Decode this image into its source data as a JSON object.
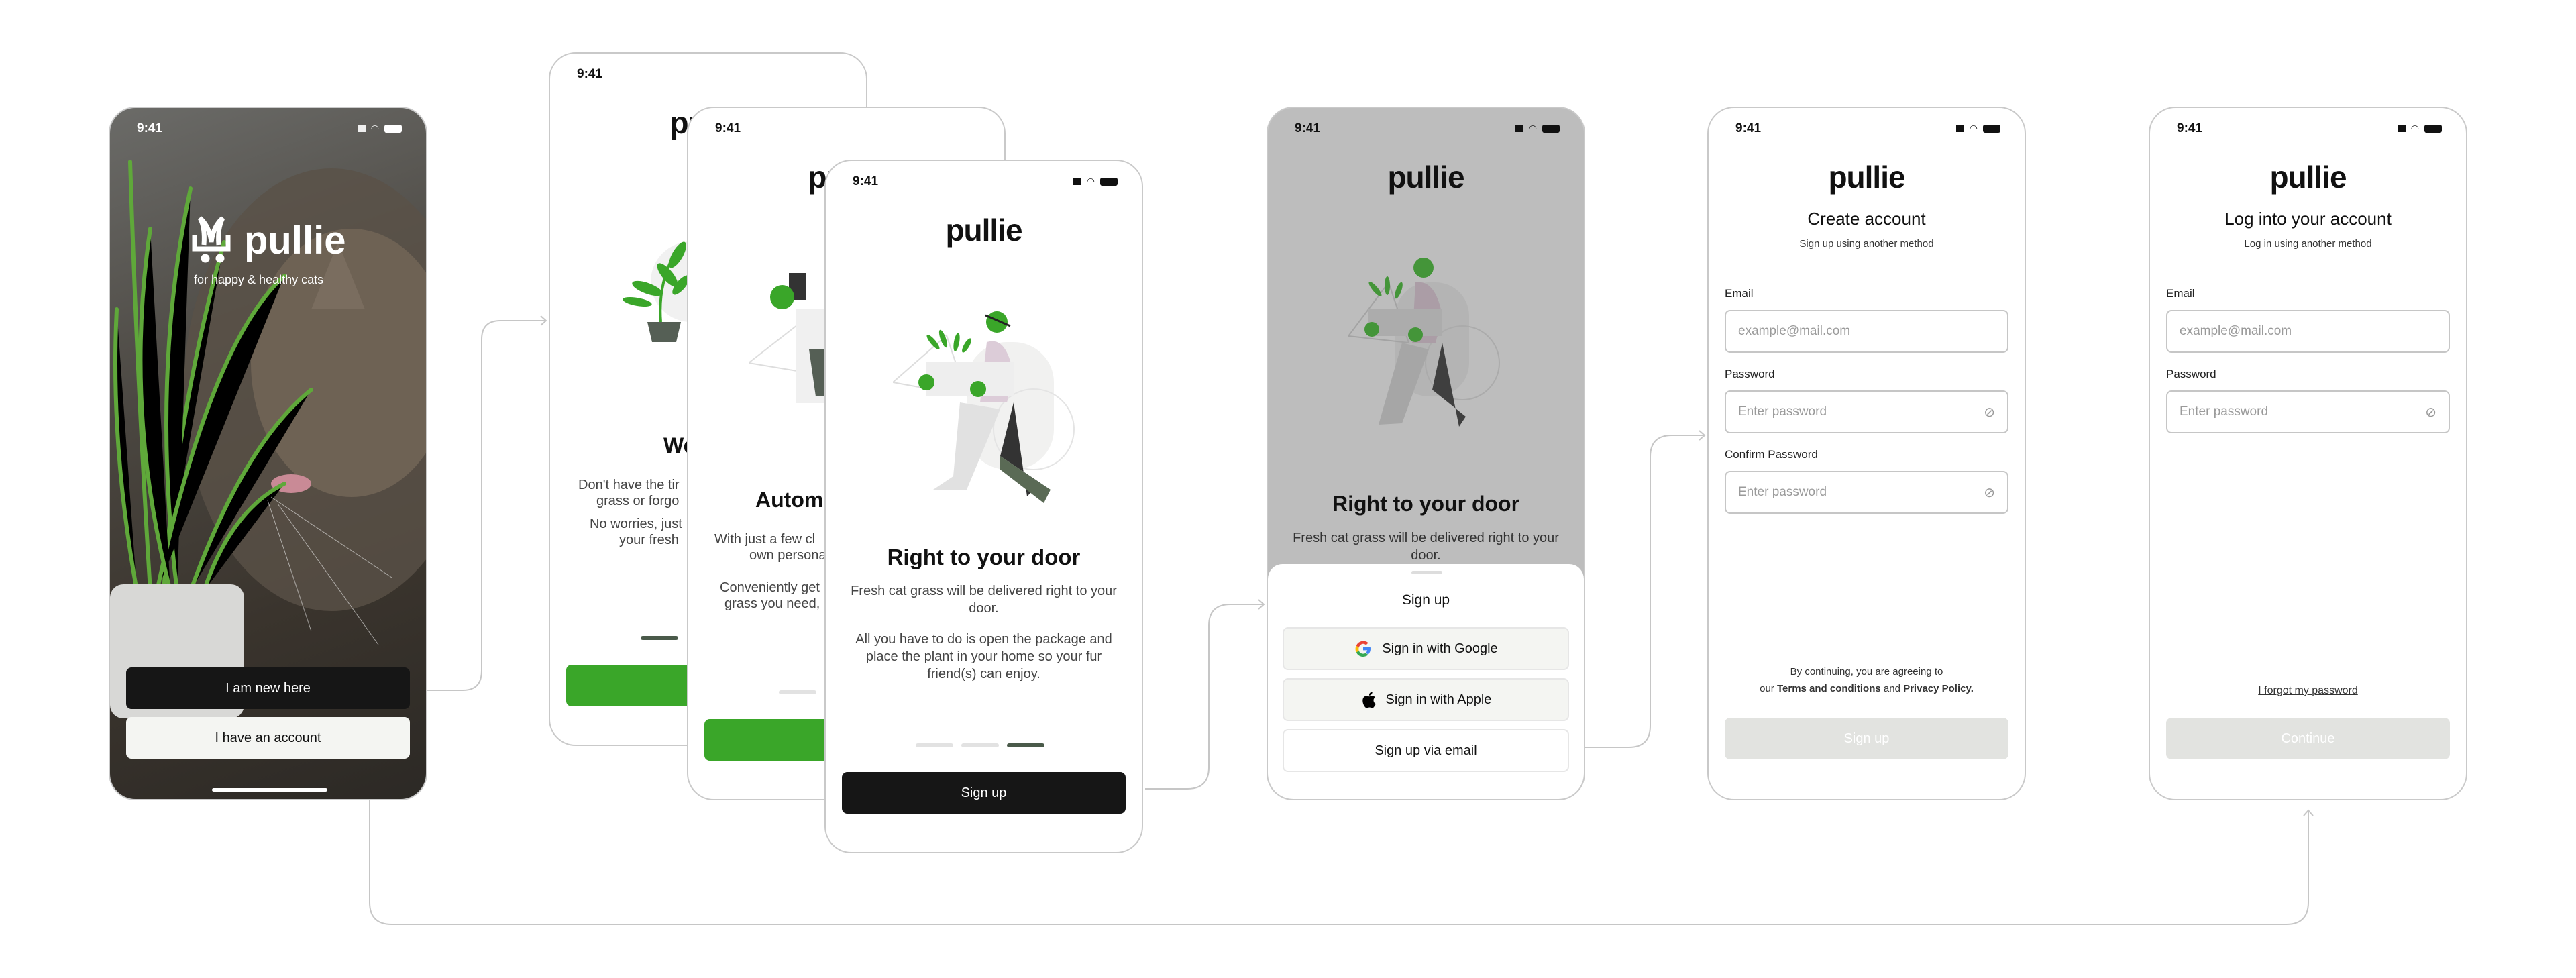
{
  "status_time": "9:41",
  "brand": "pullie",
  "colors": {
    "accent_green": "#3aa629",
    "dark_button": "#161616",
    "overlay_gray": "#bdbdbd"
  },
  "splash": {
    "tagline": "for happy & healthy cats",
    "new_button": "I am new here",
    "account_button": "I have an account"
  },
  "onboarding1": {
    "title_fragment": "We",
    "lines": [
      "Don't have the tir",
      "grass or forgo",
      "No worries, just",
      "your fresh"
    ]
  },
  "onboarding2": {
    "title_fragment": "Automa",
    "lines": [
      "With just a few cl",
      "own persona",
      "Conveniently get",
      "grass you need,"
    ]
  },
  "onboarding3": {
    "title": "Right to your door",
    "para1": "Fresh cat grass will be delivered right to your door.",
    "para2": "All you have to do is open the package and place the plant in your home so your fur friend(s) can enjoy.",
    "button": "Sign up",
    "page": 3,
    "pages": 3
  },
  "signup_sheet": {
    "bg_title": "Right to your door",
    "bg_text": "Fresh cat grass will be delivered right to your door.",
    "title": "Sign up",
    "google": "Sign in with Google",
    "apple": "Sign in with Apple",
    "email": "Sign up via email"
  },
  "create_account": {
    "title": "Create account",
    "alt_link": "Sign up using another method",
    "email_label": "Email",
    "email_placeholder": "example@mail.com",
    "password_label": "Password",
    "password_placeholder": "Enter password",
    "confirm_label": "Confirm Password",
    "confirm_placeholder": "Enter password",
    "terms_pre": "By continuing, you are agreeing to",
    "terms_our": "our",
    "terms_link": "Terms and conditions",
    "terms_and": "and",
    "privacy_link": "Privacy Policy.",
    "button": "Sign up"
  },
  "login": {
    "title": "Log into your account",
    "alt_link": "Log in using another method",
    "email_label": "Email",
    "email_placeholder": "example@mail.com",
    "password_label": "Password",
    "password_placeholder": "Enter password",
    "forgot": "I forgot my password",
    "button": "Continue"
  }
}
